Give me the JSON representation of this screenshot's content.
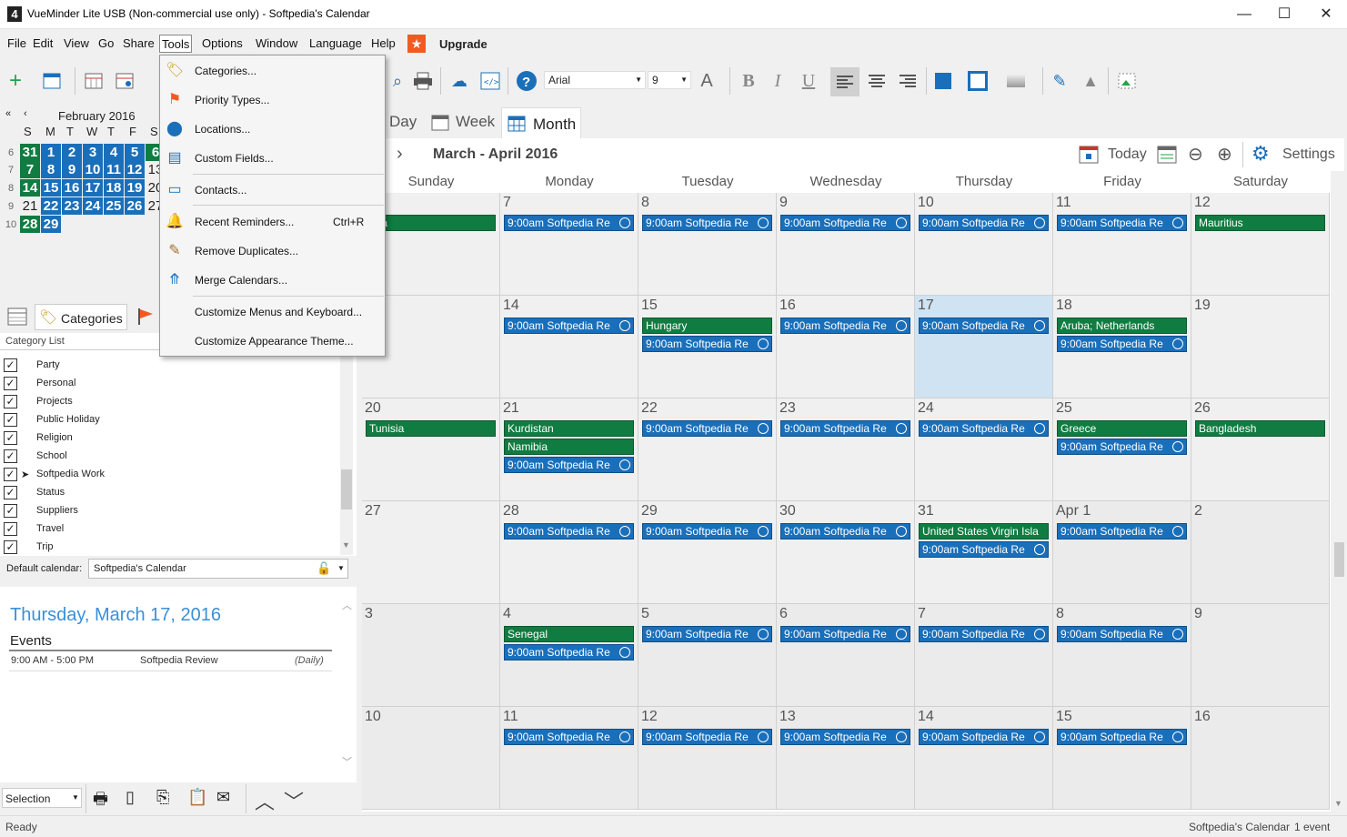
{
  "window": {
    "title": "VueMinder Lite USB (Non-commercial use only) - Softpedia's Calendar",
    "app_icon": "4",
    "min": "—",
    "max": "☐",
    "close": "✕"
  },
  "menubar": {
    "items": [
      "File",
      "Edit",
      "View",
      "Go",
      "Share",
      "Tools",
      "Options",
      "Window",
      "Language",
      "Help"
    ],
    "upgrade": "Upgrade"
  },
  "toolbar": {
    "font": "Arial",
    "size": "9"
  },
  "minimonth": {
    "title": "February 2016",
    "dow": [
      "S",
      "M",
      "T",
      "W",
      "T",
      "F",
      "S"
    ],
    "weeks": [
      "6",
      "7",
      "8",
      "9",
      "10"
    ],
    "rows": [
      [
        "31",
        "1",
        "2",
        "3",
        "4",
        "5",
        "6"
      ],
      [
        "7",
        "8",
        "9",
        "10",
        "11",
        "12",
        "13"
      ],
      [
        "14",
        "15",
        "16",
        "17",
        "18",
        "19",
        "20"
      ],
      [
        "21",
        "22",
        "23",
        "24",
        "25",
        "26",
        "27"
      ],
      [
        "28",
        "29"
      ]
    ]
  },
  "left_tabs": {
    "categories": "Categories"
  },
  "category_list": {
    "header": "Category List",
    "items": [
      "Party",
      "Personal",
      "Projects",
      "Public Holiday",
      "Religion",
      "School",
      "Softpedia Work",
      "Status",
      "Suppliers",
      "Travel",
      "Trip"
    ]
  },
  "default_calendar": {
    "label": "Default calendar:",
    "value": "Softpedia's Calendar"
  },
  "details": {
    "date": "Thursday, March 17, 2016",
    "section": "Events",
    "event_time": "9:00 AM - 5:00 PM",
    "event_name": "Softpedia Review",
    "event_recur": "(Daily)"
  },
  "bottom": {
    "selection": "Selection"
  },
  "view_tabs": {
    "day": "Day",
    "week": "Week",
    "month": "Month"
  },
  "cal_header": {
    "range": "March - April 2016",
    "today": "Today",
    "settings": "Settings"
  },
  "dow": [
    "Sunday",
    "Monday",
    "Tuesday",
    "Wednesday",
    "Thursday",
    "Friday",
    "Saturday"
  ],
  "weeks": [
    [
      {
        "d": "r 6",
        "ev": [
          [
            "g",
            "ana"
          ]
        ]
      },
      {
        "d": "7",
        "ev": [
          [
            "b",
            "9:00am Softpedia Re"
          ]
        ]
      },
      {
        "d": "8",
        "ev": [
          [
            "b",
            "9:00am Softpedia Re"
          ]
        ]
      },
      {
        "d": "9",
        "ev": [
          [
            "b",
            "9:00am Softpedia Re"
          ]
        ]
      },
      {
        "d": "10",
        "ev": [
          [
            "b",
            "9:00am Softpedia Re"
          ]
        ]
      },
      {
        "d": "11",
        "ev": [
          [
            "b",
            "9:00am Softpedia Re"
          ]
        ]
      },
      {
        "d": "12",
        "ev": [
          [
            "g",
            "Mauritius"
          ]
        ]
      }
    ],
    [
      {
        "d": "",
        "ev": []
      },
      {
        "d": "14",
        "ev": [
          [
            "b",
            "9:00am Softpedia Re"
          ]
        ]
      },
      {
        "d": "15",
        "ev": [
          [
            "g",
            "Hungary"
          ],
          [
            "b",
            "9:00am Softpedia Re"
          ]
        ]
      },
      {
        "d": "16",
        "ev": [
          [
            "b",
            "9:00am Softpedia Re"
          ]
        ]
      },
      {
        "d": "17",
        "ev": [
          [
            "b",
            "9:00am Softpedia Re"
          ]
        ],
        "today": true
      },
      {
        "d": "18",
        "ev": [
          [
            "g",
            "Aruba; Netherlands"
          ],
          [
            "b",
            "9:00am Softpedia Re"
          ]
        ]
      },
      {
        "d": "19",
        "ev": []
      }
    ],
    [
      {
        "d": "20",
        "ev": [
          [
            "g",
            "Tunisia"
          ]
        ]
      },
      {
        "d": "21",
        "ev": [
          [
            "g",
            "Kurdistan"
          ],
          [
            "g",
            "Namibia"
          ],
          [
            "b",
            "9:00am Softpedia Re"
          ]
        ]
      },
      {
        "d": "22",
        "ev": [
          [
            "b",
            "9:00am Softpedia Re"
          ]
        ]
      },
      {
        "d": "23",
        "ev": [
          [
            "b",
            "9:00am Softpedia Re"
          ]
        ]
      },
      {
        "d": "24",
        "ev": [
          [
            "b",
            "9:00am Softpedia Re"
          ]
        ]
      },
      {
        "d": "25",
        "ev": [
          [
            "g",
            "Greece"
          ],
          [
            "b",
            "9:00am Softpedia Re"
          ]
        ]
      },
      {
        "d": "26",
        "ev": [
          [
            "g",
            "Bangladesh"
          ]
        ]
      }
    ],
    [
      {
        "d": "27",
        "ev": []
      },
      {
        "d": "28",
        "ev": [
          [
            "b",
            "9:00am Softpedia Re"
          ]
        ]
      },
      {
        "d": "29",
        "ev": [
          [
            "b",
            "9:00am Softpedia Re"
          ]
        ]
      },
      {
        "d": "30",
        "ev": [
          [
            "b",
            "9:00am Softpedia Re"
          ]
        ]
      },
      {
        "d": "31",
        "ev": [
          [
            "g",
            "United States Virgin Isla"
          ],
          [
            "b",
            "9:00am Softpedia Re"
          ]
        ]
      },
      {
        "d": "Apr 1",
        "ev": [
          [
            "b",
            "9:00am Softpedia Re"
          ]
        ],
        "dim": true
      },
      {
        "d": "2",
        "ev": [],
        "dim": true
      }
    ],
    [
      {
        "d": "3",
        "ev": [],
        "dim": true
      },
      {
        "d": "4",
        "ev": [
          [
            "g",
            "Senegal"
          ],
          [
            "b",
            "9:00am Softpedia Re"
          ]
        ],
        "dim": true
      },
      {
        "d": "5",
        "ev": [
          [
            "b",
            "9:00am Softpedia Re"
          ]
        ],
        "dim": true
      },
      {
        "d": "6",
        "ev": [
          [
            "b",
            "9:00am Softpedia Re"
          ]
        ],
        "dim": true
      },
      {
        "d": "7",
        "ev": [
          [
            "b",
            "9:00am Softpedia Re"
          ]
        ],
        "dim": true
      },
      {
        "d": "8",
        "ev": [
          [
            "b",
            "9:00am Softpedia Re"
          ]
        ],
        "dim": true
      },
      {
        "d": "9",
        "ev": [],
        "dim": true
      }
    ],
    [
      {
        "d": "10",
        "ev": [],
        "dim": true
      },
      {
        "d": "11",
        "ev": [
          [
            "b",
            "9:00am Softpedia Re"
          ]
        ],
        "dim": true
      },
      {
        "d": "12",
        "ev": [
          [
            "b",
            "9:00am Softpedia Re"
          ]
        ],
        "dim": true
      },
      {
        "d": "13",
        "ev": [
          [
            "b",
            "9:00am Softpedia Re"
          ]
        ],
        "dim": true
      },
      {
        "d": "14",
        "ev": [
          [
            "b",
            "9:00am Softpedia Re"
          ]
        ],
        "dim": true
      },
      {
        "d": "15",
        "ev": [
          [
            "b",
            "9:00am Softpedia Re"
          ]
        ],
        "dim": true
      },
      {
        "d": "16",
        "ev": [],
        "dim": true
      }
    ]
  ],
  "tools_menu": [
    {
      "label": "Categories...",
      "icon": "tag-icon"
    },
    {
      "label": "Priority Types...",
      "icon": "flag-icon"
    },
    {
      "label": "Locations...",
      "icon": "location-pin-icon"
    },
    {
      "label": "Custom Fields...",
      "icon": "custom-field-icon"
    },
    {
      "label": "Contacts...",
      "icon": "contact-card-icon"
    },
    {
      "label": "Recent Reminders...",
      "shortcut": "Ctrl+R",
      "icon": "bell-icon"
    },
    {
      "label": "Remove Duplicates...",
      "icon": "broom-icon"
    },
    {
      "label": "Merge Calendars...",
      "icon": "merge-icon"
    },
    {
      "label": "Customize Menus and Keyboard..."
    },
    {
      "label": "Customize Appearance Theme..."
    }
  ],
  "status": {
    "left": "Ready",
    "calendar": "Softpedia's Calendar",
    "count": "1 event"
  },
  "colors": {
    "green": "#107c41",
    "blue": "#1a6fba",
    "today": "#cfe3f3",
    "orange": "#f25a22"
  }
}
